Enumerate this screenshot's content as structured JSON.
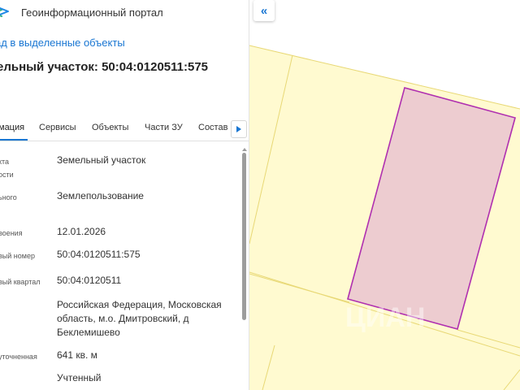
{
  "header": {
    "title": "Геоинформационный портал"
  },
  "back_link": "ад в выделенные объекты",
  "object_title": "ельный участок: 50:04:0120511:575",
  "tabs": [
    "мация",
    "Сервисы",
    "Объекты",
    "Части ЗУ",
    "Состав"
  ],
  "tabs_active_index": 0,
  "properties": [
    {
      "label_lines": [
        "кта",
        "ости"
      ],
      "value": "Земельный участок"
    },
    {
      "label_lines": [
        "ьного"
      ],
      "value": "Землепользование"
    },
    {
      "label_lines": [
        "воения"
      ],
      "value": "12.01.2026"
    },
    {
      "label_lines": [
        "вый номер"
      ],
      "value": "50:04:0120511:575"
    },
    {
      "label_lines": [
        "вый квартал"
      ],
      "value": "50:04:0120511"
    },
    {
      "label_lines": [],
      "value": "Российская Федерация, Московская область, м.о. Дмитровский, д Беклемишево"
    },
    {
      "label_lines": [
        "уточненная"
      ],
      "value": "641 кв. м"
    },
    {
      "label_lines": [],
      "value": "Учтенный"
    }
  ],
  "map": {
    "collapse_icon_glyph": "«",
    "watermark": "ЦИАН",
    "colors": {
      "parcel_fill": "#fffad0",
      "parcel_border": "#e8d875",
      "selected_fill": "#edccd0",
      "selected_border": "#b030b0"
    }
  }
}
